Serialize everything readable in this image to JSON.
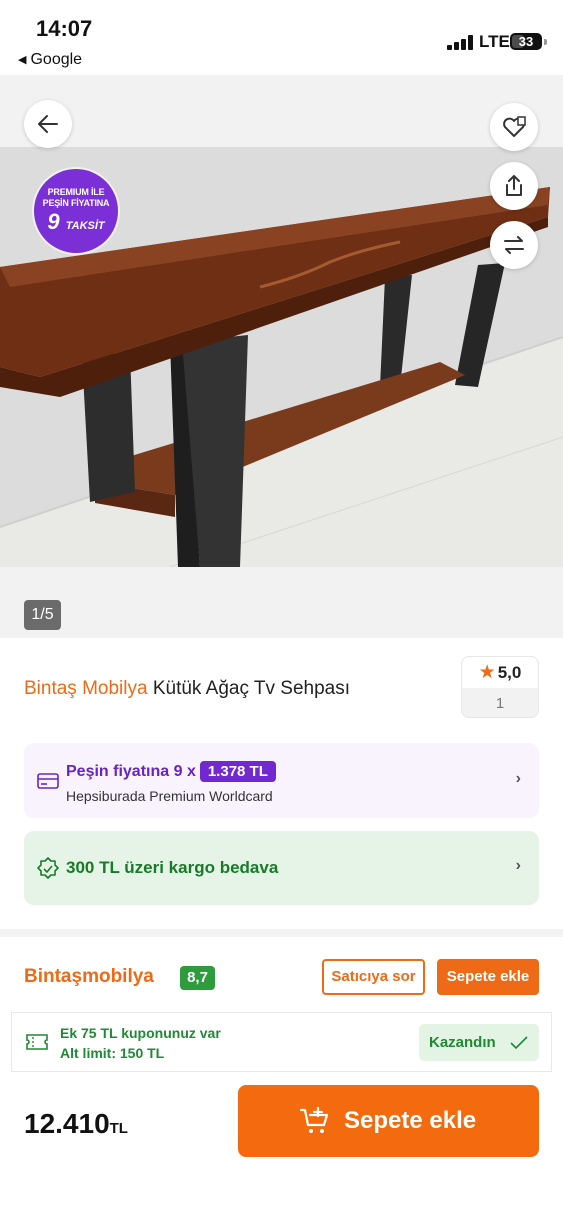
{
  "status_bar": {
    "time": "14:07",
    "back_app": "Google",
    "network": "LTE",
    "battery": "33"
  },
  "gallery": {
    "promo_badge": {
      "line1": "PREMIUM İLE",
      "line2": "PEŞİN FİYATINA",
      "line3_number": "9",
      "line3_word": "TAKSİT"
    },
    "counter": "1/5",
    "buttons": [
      "back-arrow-icon",
      "favorite-heart-icon",
      "share-icon",
      "compare-icon"
    ]
  },
  "product": {
    "brand": "Bintaş Mobilya",
    "name": "Kütük Ağaç Tv Sehpası",
    "rating": "5,0",
    "review_count": "1"
  },
  "premium": {
    "text": "Peşin fiyatına 9 x",
    "amount": "1.378 TL",
    "card": "Hepsiburada Premium Worldcard"
  },
  "cargo": {
    "text": "300 TL üzeri kargo bedava"
  },
  "seller": {
    "name": "Bintaşmobilya",
    "score": "8,7",
    "ask_label": "Satıcıya sor",
    "add_label": "Sepete ekle"
  },
  "coupon": {
    "line1": "Ek 75 TL kuponunuz var",
    "line2": "Alt limit: 150 TL",
    "won_label": "Kazandın"
  },
  "bottom": {
    "price": "12.410",
    "currency": "TL",
    "cart_label": "Sepete ekle"
  },
  "colors": {
    "brand_orange": "#ee6a16",
    "premium_purple": "#7128d0",
    "success_green": "#1f8a33"
  }
}
